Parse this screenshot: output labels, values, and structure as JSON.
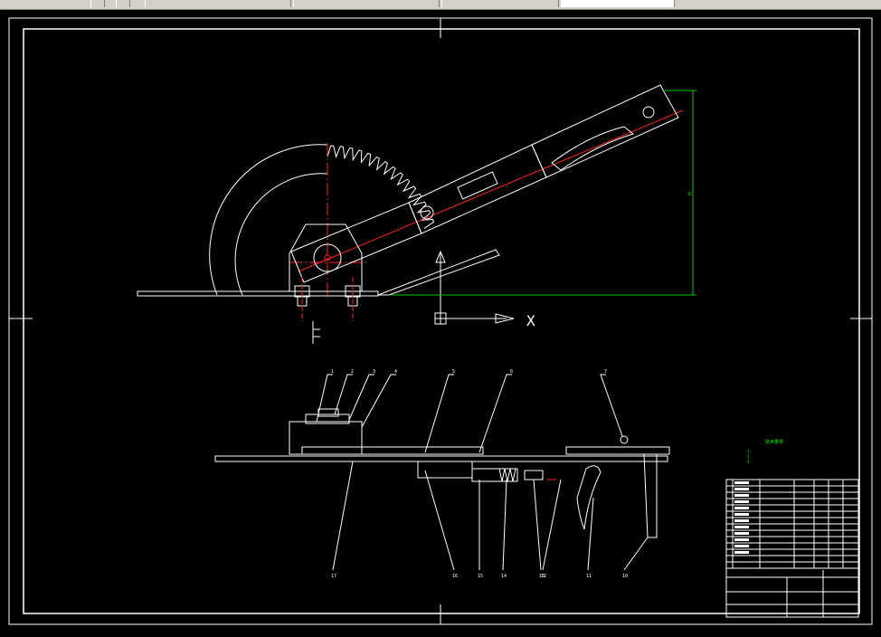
{
  "toolbar": {
    "items": [
      "",
      "",
      "",
      "",
      ""
    ],
    "layer_field_value": ""
  },
  "drawing": {
    "x_axis_label": "X",
    "dimension_label": "a",
    "note_title": "技术要求",
    "note_lines": [
      "1.",
      "2.",
      "3."
    ],
    "balloons_top": [
      "1",
      "2",
      "3",
      "4",
      "5",
      "6",
      "7"
    ],
    "balloons_bottom": [
      "17",
      "16",
      "15",
      "14",
      "13",
      "12",
      "11",
      "10"
    ],
    "left_balloons": [
      "1",
      "2"
    ]
  },
  "colors": {
    "background": "#000000",
    "line": "#ffffff",
    "center_line": "#ff2020",
    "dimension": "#00c800",
    "note": "#00ff00"
  },
  "title_block": {
    "part_name": "",
    "drawing_no": "",
    "rows": 14
  }
}
